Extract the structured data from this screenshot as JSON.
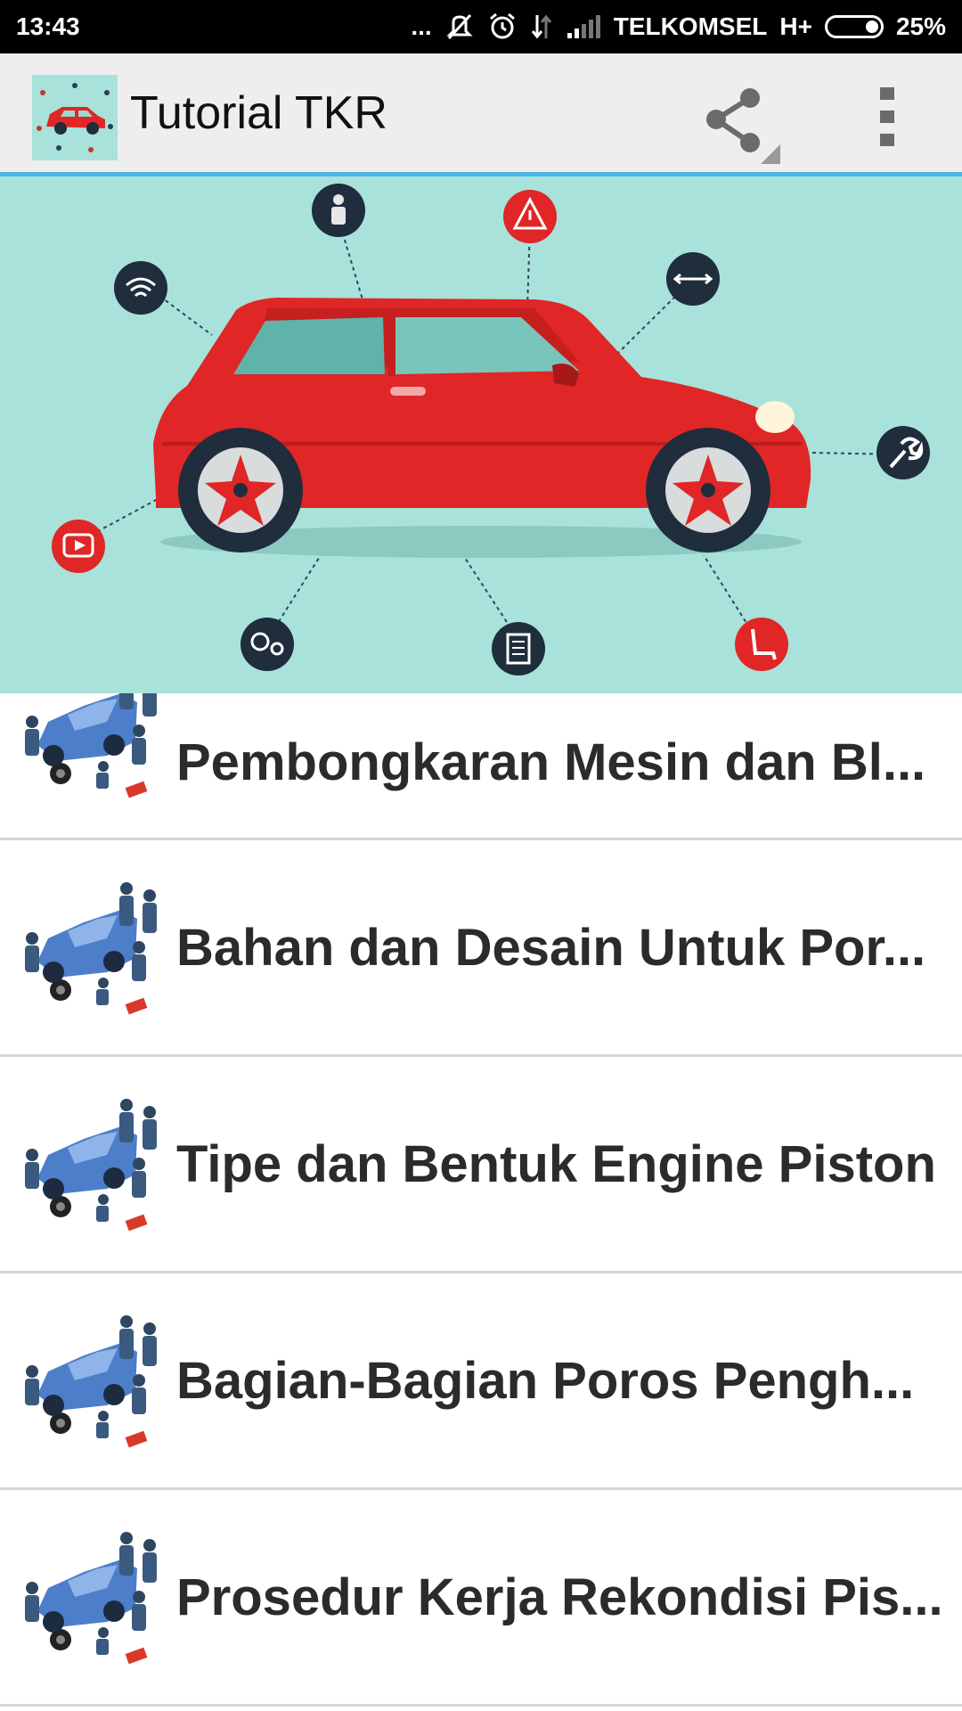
{
  "status_bar": {
    "time": "13:43",
    "dots": "...",
    "carrier": "TELKOMSEL",
    "network": "H+",
    "battery": "25%"
  },
  "app_bar": {
    "title": "Tutorial TKR",
    "icons": [
      "car-logo-icon",
      "share-icon",
      "overflow-menu-icon"
    ]
  },
  "banner": {
    "icons": [
      "seatbelt-icon",
      "warning-icon",
      "wifi-icon",
      "width-arrows-icon",
      "wrench-icon",
      "video-play-icon",
      "gears-icon",
      "document-icon",
      "car-seat-icon"
    ]
  },
  "list": {
    "items": [
      {
        "label": "Pembongkaran Mesin dan Bl..."
      },
      {
        "label": "Bahan dan Desain Untuk Por..."
      },
      {
        "label": "Tipe dan Bentuk Engine Piston"
      },
      {
        "label": "Bagian-Bagian Poros Pengh..."
      },
      {
        "label": "Prosedur Kerja Rekondisi Pis..."
      }
    ]
  },
  "colors": {
    "status_bar_bg": "#000000",
    "app_bar_bg": "#eeeeee",
    "accent_line": "#4fb3e6",
    "banner_bg": "#a8e2da",
    "car_red": "#e02626",
    "list_text": "#2b2b2b"
  }
}
